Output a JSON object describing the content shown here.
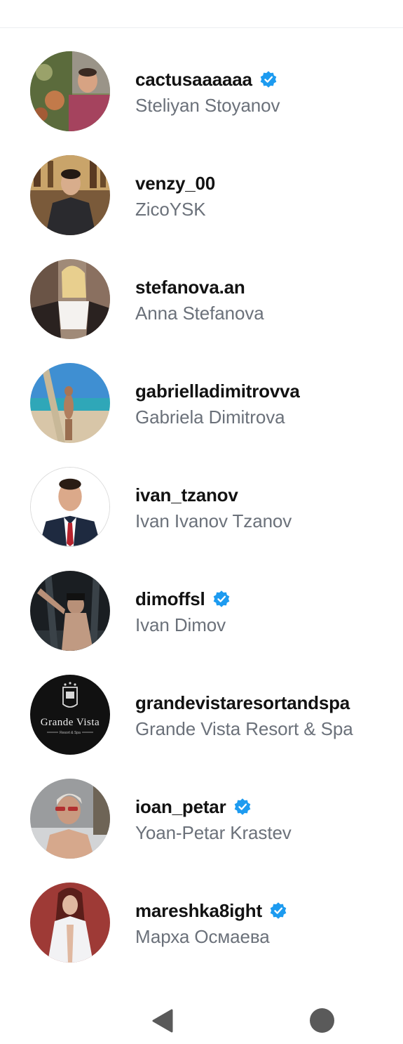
{
  "accounts": [
    {
      "username": "cactusaaaaaa",
      "full_name": "Steliyan Stoyanov",
      "verified": true
    },
    {
      "username": "venzy_00",
      "full_name": "ZicoYSK",
      "verified": false
    },
    {
      "username": "stefanova.an",
      "full_name": "Anna Stefanova",
      "verified": false
    },
    {
      "username": "gabrielladimitrovva",
      "full_name": "Gabriela Dimitrova",
      "verified": false
    },
    {
      "username": "ivan_tzanov",
      "full_name": "Ivan Ivanov Tzanov",
      "verified": false
    },
    {
      "username": "dimoffsl",
      "full_name": "Ivan Dimov",
      "verified": true
    },
    {
      "username": "grandevistaresortandspa",
      "full_name": "Grande Vista Resort & Spa",
      "verified": false,
      "logo_text": "Grande Vista",
      "logo_subtext": "Resort & Spa"
    },
    {
      "username": "ioan_petar",
      "full_name": "Yoan-Petar Krastev",
      "verified": true
    },
    {
      "username": "mareshka8ight",
      "full_name": "Марха Осмаева",
      "verified": true
    }
  ],
  "colors": {
    "verified_badge": "#1d9bf0",
    "username_text": "#121212",
    "fullname_text": "#6b717a"
  },
  "icons": {
    "verified": "verified-badge-icon",
    "nav_back": "back-triangle-icon",
    "nav_home": "home-circle-icon"
  }
}
